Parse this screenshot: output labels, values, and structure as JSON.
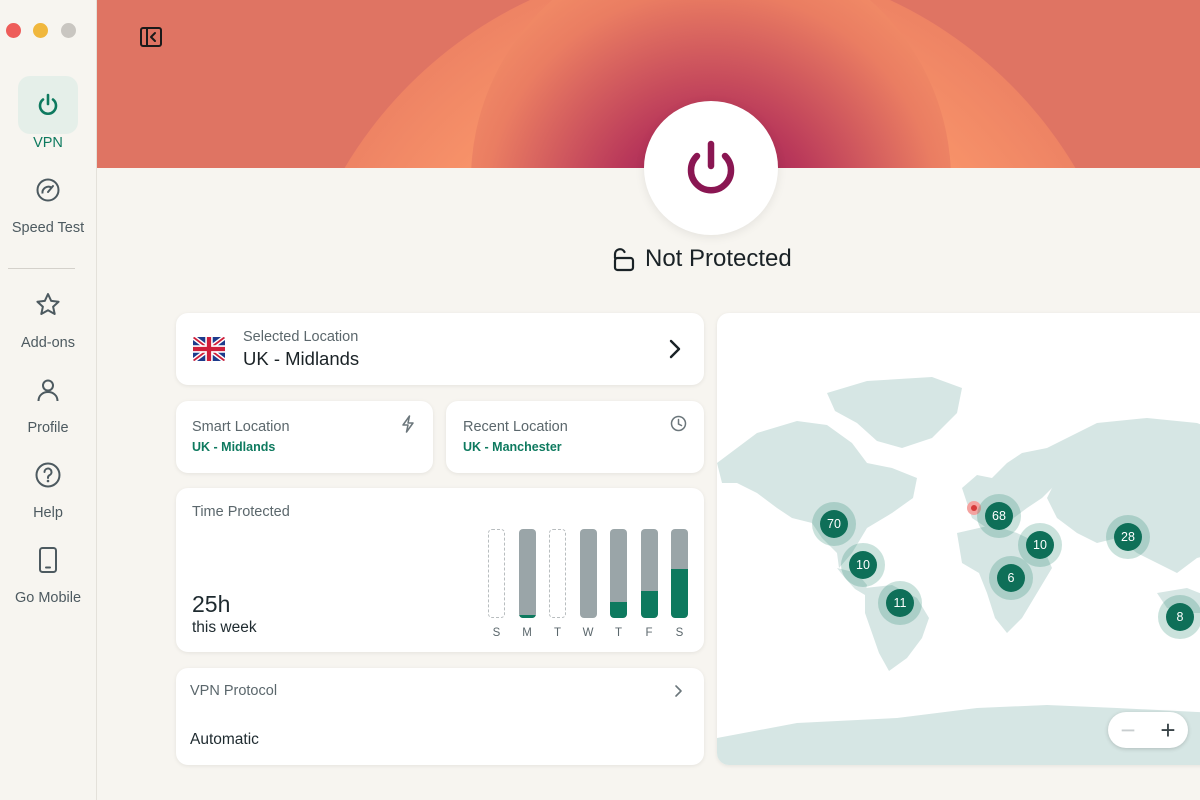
{
  "sidebar": {
    "items": [
      {
        "label": "VPN",
        "icon": "power-icon"
      },
      {
        "label": "Speed Test",
        "icon": "speedometer-icon"
      },
      {
        "label": "Add-ons",
        "icon": "star-icon"
      },
      {
        "label": "Profile",
        "icon": "person-icon"
      },
      {
        "label": "Help",
        "icon": "question-icon"
      },
      {
        "label": "Go Mobile",
        "icon": "phone-icon"
      }
    ]
  },
  "status": {
    "text": "Not Protected",
    "icon": "unlocked-padlock-icon"
  },
  "selected_location": {
    "label": "Selected Location",
    "value": "UK - Midlands",
    "flag": "uk-flag-icon"
  },
  "smart_location": {
    "label": "Smart Location",
    "value": "UK - Midlands",
    "icon": "lightning-icon"
  },
  "recent_location": {
    "label": "Recent Location",
    "value": "UK - Manchester",
    "icon": "clock-icon"
  },
  "time_protected": {
    "label": "Time Protected",
    "hours": "25h",
    "period": "this week",
    "days": [
      {
        "day": "S",
        "fill": null
      },
      {
        "day": "M",
        "fill": 0.03
      },
      {
        "day": "T",
        "fill": null
      },
      {
        "day": "W",
        "fill": 0.0
      },
      {
        "day": "T",
        "fill": 0.18
      },
      {
        "day": "F",
        "fill": 0.3
      },
      {
        "day": "S",
        "fill": 0.55
      }
    ]
  },
  "vpn_protocol": {
    "label": "VPN Protocol",
    "value": "Automatic"
  },
  "map": {
    "clusters": [
      "70",
      "68",
      "10",
      "10",
      "28",
      "6",
      "11",
      "8"
    ],
    "zoom_out": "−",
    "zoom_in": "+"
  },
  "colors": {
    "accent": "#0e7a5f",
    "power": "#8a1652",
    "banner": "#df7463"
  }
}
